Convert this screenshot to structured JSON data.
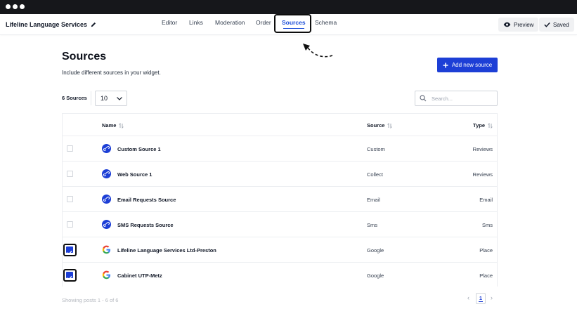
{
  "project": {
    "name": "Lifeline Language Services"
  },
  "tabs": [
    {
      "label": "Editor"
    },
    {
      "label": "Links"
    },
    {
      "label": "Moderation"
    },
    {
      "label": "Order"
    },
    {
      "label": "Sources"
    },
    {
      "label": "Schema"
    }
  ],
  "actions": {
    "preview_label": "Preview",
    "saved_label": "Saved"
  },
  "page": {
    "title": "Sources",
    "subtitle": "Include different sources in your widget.",
    "add_button": "Add new source"
  },
  "toolbar": {
    "count_label": "6 Sources",
    "per_page": "10",
    "search_placeholder": "Search..."
  },
  "table": {
    "columns": {
      "name": "Name",
      "source": "Source",
      "type": "Type"
    },
    "rows": [
      {
        "name": "Custom Source 1",
        "source": "Custom",
        "type": "Reviews",
        "icon": "link-icon",
        "checked": false
      },
      {
        "name": "Web Source 1",
        "source": "Collect",
        "type": "Reviews",
        "icon": "link-icon",
        "checked": false
      },
      {
        "name": "Email Requests Source",
        "source": "Email",
        "type": "Email",
        "icon": "link-icon",
        "checked": false
      },
      {
        "name": "SMS Requests Source",
        "source": "Sms",
        "type": "Sms",
        "icon": "link-icon",
        "checked": false
      },
      {
        "name": "Lifeline Language Services Ltd-Preston",
        "source": "Google",
        "type": "Place",
        "icon": "google-icon",
        "checked": true
      },
      {
        "name": "Cabinet UTP-Metz",
        "source": "Google",
        "type": "Place",
        "icon": "google-icon",
        "checked": true
      }
    ]
  },
  "footer": {
    "showing": "Showing posts 1 - 6 of 6",
    "current_page": "1",
    "prev_glyph": "‹",
    "next_glyph": "›"
  },
  "colors": {
    "accent": "#1d3fd6",
    "titlebar": "#16171b",
    "highlight_frame": "#0d0d0d"
  }
}
